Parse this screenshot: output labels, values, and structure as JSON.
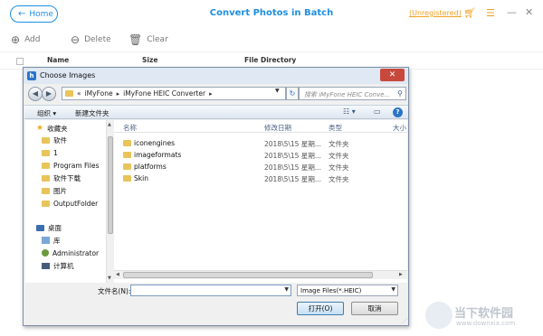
{
  "app": {
    "home_label": "Home",
    "title": "Convert Photos in Batch",
    "unregistered": "(Unregistered)",
    "toolbar": {
      "add": "Add",
      "delete": "Delete",
      "clear": "Clear"
    },
    "columns": {
      "name": "Name",
      "size": "Size",
      "dir": "File Directory"
    },
    "accent_color": "#1e8fe1",
    "warning_color": "#f0a020"
  },
  "dialog": {
    "title": "Choose Images",
    "breadcrumb": [
      "«",
      "iMyFone",
      "iMyFone HEIC Converter"
    ],
    "search_placeholder": "搜索 iMyFone HEIC Conve...",
    "commands": {
      "organize": "组织 ▾",
      "new_folder": "新建文件夹"
    },
    "tree": [
      {
        "label": "收藏夹",
        "kind": "favorites"
      },
      {
        "label": "软件",
        "kind": "folder"
      },
      {
        "label": "1",
        "kind": "folder"
      },
      {
        "label": "Program Files",
        "kind": "folder"
      },
      {
        "label": "软件下载",
        "kind": "folder"
      },
      {
        "label": "图片",
        "kind": "folder"
      },
      {
        "label": "OutputFolder",
        "kind": "folder"
      },
      {
        "label": "桌面",
        "kind": "desktop"
      },
      {
        "label": "库",
        "kind": "library"
      },
      {
        "label": "Administrator",
        "kind": "user"
      },
      {
        "label": "计算机",
        "kind": "computer"
      }
    ],
    "file_columns": {
      "name": "名称",
      "date": "修改日期",
      "type": "类型",
      "size": "大小"
    },
    "files": [
      {
        "name": "iconengines",
        "date": "2018\\5\\15 星期...",
        "type": "文件夹"
      },
      {
        "name": "imageformats",
        "date": "2018\\5\\15 星期...",
        "type": "文件夹"
      },
      {
        "name": "platforms",
        "date": "2018\\5\\15 星期...",
        "type": "文件夹"
      },
      {
        "name": "Skin",
        "date": "2018\\5\\15 星期...",
        "type": "文件夹"
      }
    ],
    "filename_label": "文件名(N):",
    "filename_value": "",
    "filter": "Image Files(*.HEIC)",
    "open_label": "打开(O)",
    "cancel_label": "取消"
  },
  "watermark": {
    "text": "当下软件园",
    "url": "www.downxia.com"
  }
}
